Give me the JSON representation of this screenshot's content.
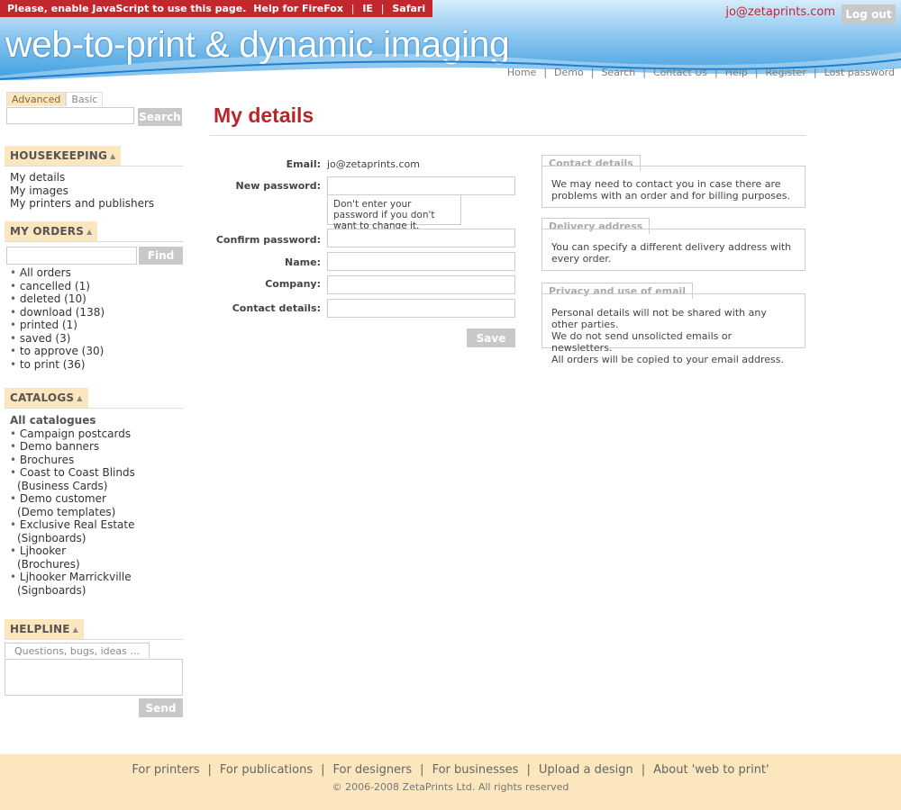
{
  "header": {
    "js_warning": {
      "text": "Please, enable JavaScript to use this page.",
      "help_label": "Help for FireFox",
      "links": [
        "IE",
        "Safari"
      ],
      "separator": "|"
    },
    "tagline": "web-to-print & dynamic imaging",
    "user_email": "jo@zetaprints.com",
    "logout_label": "Log out",
    "nav": [
      "Home",
      "Demo",
      "Search",
      "Contact Us",
      "Help",
      "Register",
      "Lost password"
    ],
    "nav_separator": "|"
  },
  "sidebar": {
    "search": {
      "tabs": [
        "Advanced",
        "Basic"
      ],
      "button_label": "Search"
    },
    "housekeeping": {
      "title": "HOUSEKEEPING",
      "items": [
        "My details",
        "My images",
        "My printers and publishers"
      ]
    },
    "orders": {
      "title": "MY ORDERS",
      "find_label": "Find",
      "items": [
        "All orders",
        "cancelled (1)",
        "deleted (10)",
        "download (138)",
        "printed (1)",
        "saved (3)",
        "to approve (30)",
        "to print (36)"
      ]
    },
    "catalogs": {
      "title": "CATALOGS",
      "all_label": "All catalogues",
      "items": [
        {
          "name": "Campaign postcards",
          "sub": ""
        },
        {
          "name": "Demo banners",
          "sub": ""
        },
        {
          "name": "Brochures",
          "sub": ""
        },
        {
          "name": "Coast to Coast Blinds",
          "sub": "(Business Cards)"
        },
        {
          "name": "Demo customer",
          "sub": "(Demo templates)"
        },
        {
          "name": "Exclusive Real Estate",
          "sub": "(Signboards)"
        },
        {
          "name": "Ljhooker",
          "sub": "(Brochures)"
        },
        {
          "name": "Ljhooker Marrickville",
          "sub": "(Signboards)"
        }
      ]
    },
    "helpline": {
      "title": "HELPLINE",
      "tab_label": "Questions, bugs, ideas ...",
      "send_label": "Send"
    }
  },
  "main": {
    "title": "My details",
    "form": {
      "email_label": "Email:",
      "email_value": "jo@zetaprints.com",
      "new_password_label": "New password:",
      "password_hint": "Don't enter your password if you don't want to change it.",
      "confirm_password_label": "Confirm password:",
      "name_label": "Name:",
      "company_label": "Company:",
      "contact_label": "Contact details:",
      "save_label": "Save"
    },
    "info": [
      {
        "title": "Contact details",
        "text": "We may need to contact you in case there are problems with an order and for billing purposes."
      },
      {
        "title": "Delivery address",
        "text": "You can specify a different delivery address with every order."
      },
      {
        "title": "Privacy and use of email",
        "lines": [
          "Personal details will not be shared with any other parties.",
          "We do not send unsolicted emails or newsletters.",
          "All orders will be copied to your email address."
        ]
      }
    ]
  },
  "footer": {
    "links": [
      "For printers",
      "For publications",
      "For designers",
      "For businesses",
      "Upload a design",
      "About 'web to print'"
    ],
    "separator": "|",
    "copyright": "© 2006-2008 ZetaPrints Ltd. All rights reserved"
  },
  "colors": {
    "brand_red": "#c1272d",
    "accent_tab": "#fbe6bd",
    "button_gray": "#c8c8c8",
    "header_blue": "#3d9fe0"
  }
}
